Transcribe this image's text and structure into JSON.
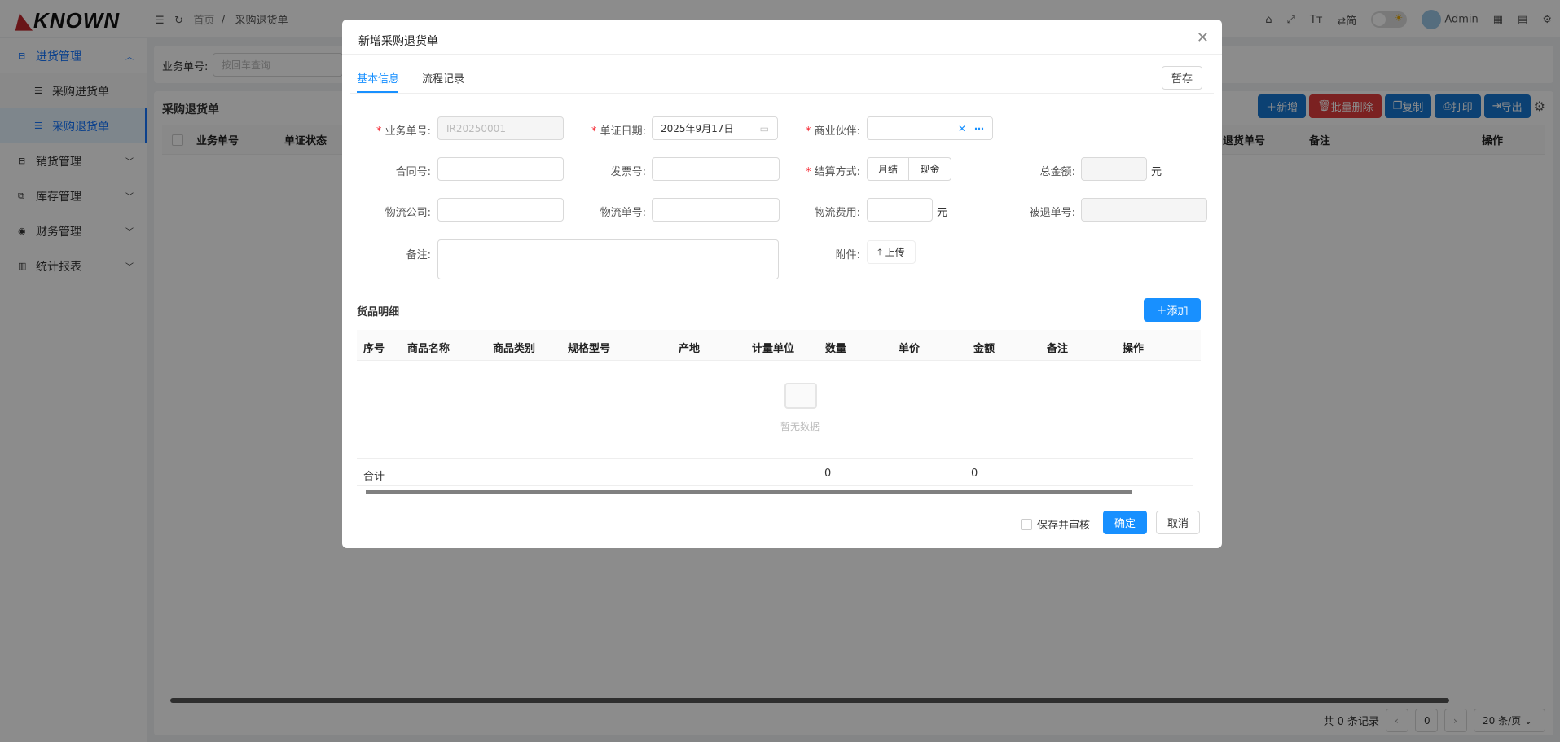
{
  "header": {
    "logo": "KNOWN",
    "breadcrumb": [
      "首页",
      "采购退货单"
    ],
    "lang": "简",
    "user": "Admin"
  },
  "sidebar": {
    "items": [
      {
        "label": "进货管理",
        "expanded": true,
        "children": [
          {
            "label": "采购进货单"
          },
          {
            "label": "采购退货单",
            "active": true
          }
        ]
      },
      {
        "label": "销货管理"
      },
      {
        "label": "库存管理"
      },
      {
        "label": "财务管理"
      },
      {
        "label": "统计报表"
      }
    ]
  },
  "search": {
    "label": "业务单号:",
    "placeholder": "按回车查询"
  },
  "list": {
    "title": "采购退货单",
    "toolbar": {
      "add": "新增",
      "batch_delete": "批量删除",
      "copy": "复制",
      "print": "打印",
      "export": "导出"
    },
    "columns": [
      "业务单号",
      "单证状态",
      "退货单号",
      "备注",
      "操作"
    ],
    "pagination": {
      "total": "共 0 条记录",
      "page": "0",
      "page_size": "20 条/页"
    }
  },
  "modal": {
    "title": "新增采购退货单",
    "tabs": [
      {
        "label": "基本信息",
        "active": true
      },
      {
        "label": "流程记录"
      }
    ],
    "save_draft": "暂存",
    "fields": {
      "biz_no": {
        "label": "业务单号:",
        "value": "IR20250001",
        "required": true
      },
      "date": {
        "label": "单证日期:",
        "value": "2025年9月17日",
        "required": true
      },
      "partner": {
        "label": "商业伙伴:",
        "value": "",
        "required": true
      },
      "contract": {
        "label": "合同号:",
        "value": ""
      },
      "invoice": {
        "label": "发票号:",
        "value": ""
      },
      "settle": {
        "label": "结算方式:",
        "options": [
          "月结",
          "现金"
        ],
        "required": true
      },
      "total": {
        "label": "总金额:",
        "unit": "元"
      },
      "logistics_co": {
        "label": "物流公司:",
        "value": ""
      },
      "logistics_no": {
        "label": "物流单号:",
        "value": ""
      },
      "logistics_fee": {
        "label": "物流费用:",
        "unit": "元"
      },
      "returned_no": {
        "label": "被退单号:",
        "value": ""
      },
      "remark": {
        "label": "备注:",
        "value": ""
      },
      "attachment": {
        "label": "附件:",
        "button": "上传"
      }
    },
    "goods": {
      "title": "货品明细",
      "add": "添加",
      "columns": [
        "序号",
        "商品名称",
        "商品类别",
        "规格型号",
        "产地",
        "计量单位",
        "数量",
        "单价",
        "金额",
        "备注",
        "操作"
      ],
      "empty": "暂无数据",
      "summary_label": "合计",
      "sum_qty": "0",
      "sum_amount": "0"
    },
    "footer": {
      "save_audit": "保存并审核",
      "ok": "确定",
      "cancel": "取消"
    }
  },
  "colors": {
    "primary": "#1890ff",
    "danger": "#e03c3c",
    "toolbar_blue": "#1677d2"
  }
}
